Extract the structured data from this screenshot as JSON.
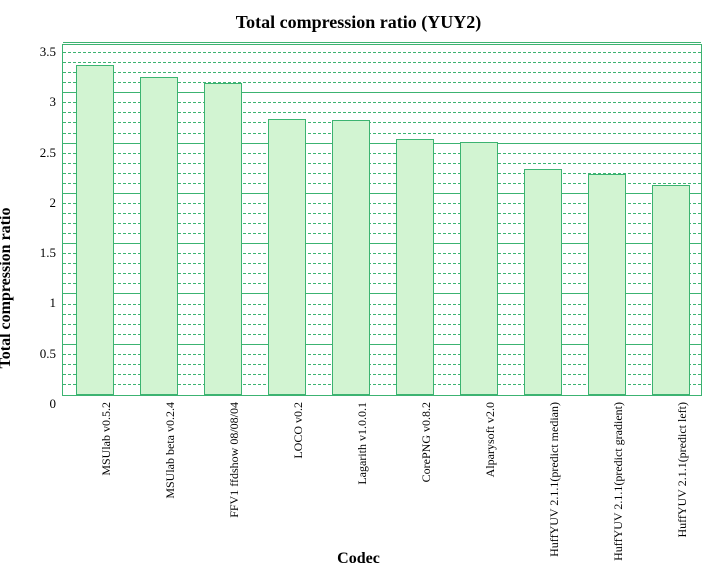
{
  "chart_data": {
    "type": "bar",
    "title": "Total compression ratio (YUY2)",
    "xlabel": "Codec",
    "ylabel": "Total compression ratio",
    "ylim": [
      0,
      3.5
    ],
    "ytick_interval_major": 0.5,
    "ytick_interval_minor": 0.1,
    "yticks": [
      0,
      0.5,
      1,
      1.5,
      2,
      2.5,
      3,
      3.5
    ],
    "categories": [
      "MSUlab v0.5.2",
      "MSUlab beta v0.2.4",
      "FFV1 ffdshow 08/08/04",
      "LOCO v0.2",
      "Lagarith v1.0.0.1",
      "CorePNG v0.8.2",
      "Alparysoft v2.0",
      "HuffYUV 2.1.1(predict median)",
      "HuffYUV 2.1.1(predict gradient)",
      "HuffYUV 2.1.1(predict left)"
    ],
    "values": [
      3.28,
      3.16,
      3.1,
      2.74,
      2.73,
      2.55,
      2.52,
      2.25,
      2.2,
      2.09
    ],
    "colors": {
      "bar_fill": "#d2f4d2",
      "bar_border": "#3cb371",
      "grid": "#3cb371"
    }
  }
}
